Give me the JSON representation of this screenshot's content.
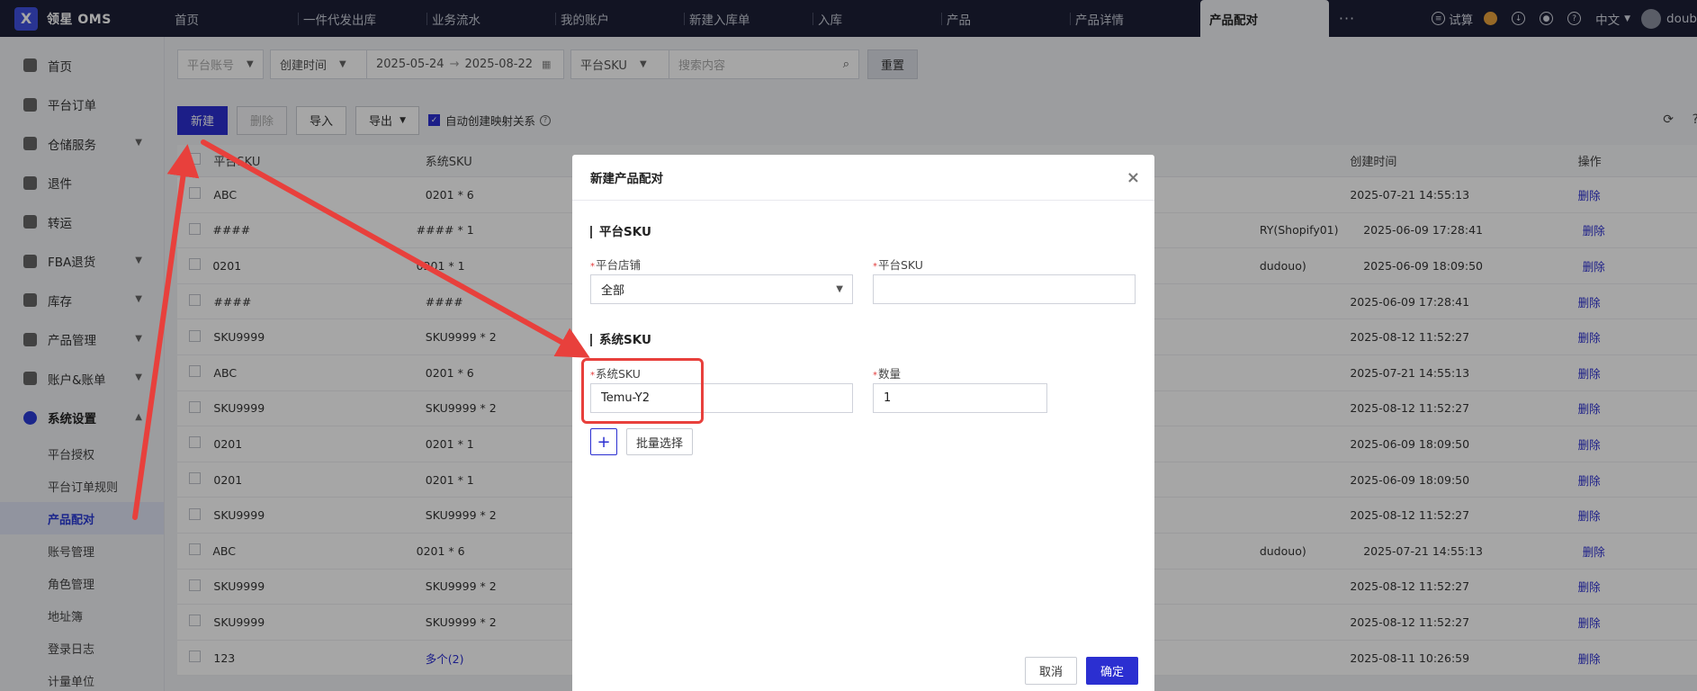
{
  "brand": {
    "name": "领星 OMS",
    "logo_letter": "X"
  },
  "top_tabs": [
    {
      "label": "首页"
    },
    {
      "label": "一件代发出库"
    },
    {
      "label": "业务流水"
    },
    {
      "label": "我的账户"
    },
    {
      "label": "新建入库单"
    },
    {
      "label": "入库"
    },
    {
      "label": "产品"
    },
    {
      "label": "产品详情"
    },
    {
      "label": "产品配对",
      "active": true
    }
  ],
  "top_more": "···",
  "top_right": {
    "trial": "试算",
    "lang": "中文",
    "user": "doub"
  },
  "sidebar": {
    "items": [
      {
        "label": "首页"
      },
      {
        "label": "平台订单"
      },
      {
        "label": "仓储服务",
        "expandable": true
      },
      {
        "label": "退件"
      },
      {
        "label": "转运"
      },
      {
        "label": "FBA退货",
        "expandable": true
      },
      {
        "label": "库存",
        "expandable": true
      },
      {
        "label": "产品管理",
        "expandable": true
      },
      {
        "label": "账户&账单",
        "expandable": true
      },
      {
        "label": "系统设置",
        "expandable": true,
        "open": true
      }
    ],
    "sub_items": [
      {
        "label": "平台授权"
      },
      {
        "label": "平台订单规则"
      },
      {
        "label": "产品配对",
        "active": true
      },
      {
        "label": "账号管理"
      },
      {
        "label": "角色管理"
      },
      {
        "label": "地址簿"
      },
      {
        "label": "登录日志"
      },
      {
        "label": "计量单位"
      }
    ]
  },
  "filters": {
    "platform_account": "平台账号",
    "time_type": "创建时间",
    "date_from": "2025-05-24",
    "date_arrow": "→",
    "date_to": "2025-08-22",
    "sku_type": "平台SKU",
    "search_placeholder": "搜索内容",
    "reset": "重置"
  },
  "toolbar": {
    "new": "新建",
    "delete": "删除",
    "import": "导入",
    "export": "导出",
    "auto_create": "自动创建映射关系"
  },
  "table": {
    "headers": {
      "platform_sku": "平台SKU",
      "system_sku": "系统SKU",
      "created": "创建时间",
      "action": "操作"
    },
    "rows": [
      {
        "psku": "ABC",
        "ssku": "0201 * 6",
        "extra": "",
        "time": "2025-07-21 14:55:13",
        "op": "删除"
      },
      {
        "psku": "####",
        "ssku": "#### * 1",
        "extra": "RY(Shopify01)",
        "time": "2025-06-09 17:28:41",
        "op": "删除"
      },
      {
        "psku": "0201",
        "ssku": "0201 * 1",
        "extra": "dudouo)",
        "time": "2025-06-09 18:09:50",
        "op": "删除"
      },
      {
        "psku": "####",
        "ssku": "####",
        "extra": "",
        "time": "2025-06-09 17:28:41",
        "op": "删除"
      },
      {
        "psku": "SKU9999",
        "ssku": "SKU9999 * 2",
        "extra": "",
        "time": "2025-08-12 11:52:27",
        "op": "删除"
      },
      {
        "psku": "ABC",
        "ssku": "0201 * 6",
        "extra": "",
        "time": "2025-07-21 14:55:13",
        "op": "删除"
      },
      {
        "psku": "SKU9999",
        "ssku": "SKU9999 * 2",
        "extra": "",
        "time": "2025-08-12 11:52:27",
        "op": "删除"
      },
      {
        "psku": "0201",
        "ssku": "0201 * 1",
        "extra": "",
        "time": "2025-06-09 18:09:50",
        "op": "删除"
      },
      {
        "psku": "0201",
        "ssku": "0201 * 1",
        "extra": "",
        "time": "2025-06-09 18:09:50",
        "op": "删除"
      },
      {
        "psku": "SKU9999",
        "ssku": "SKU9999 * 2",
        "extra": "",
        "time": "2025-08-12 11:52:27",
        "op": "删除"
      },
      {
        "psku": "ABC",
        "ssku": "0201 * 6",
        "extra": "dudouo)",
        "time": "2025-07-21 14:55:13",
        "op": "删除"
      },
      {
        "psku": "SKU9999",
        "ssku": "SKU9999 * 2",
        "extra": "",
        "time": "2025-08-12 11:52:27",
        "op": "删除"
      },
      {
        "psku": "SKU9999",
        "ssku": "SKU9999 * 2",
        "extra": "",
        "time": "2025-08-12 11:52:27",
        "op": "删除"
      },
      {
        "psku": "123",
        "ssku": "多个(2)",
        "ssku_link": true,
        "extra": "",
        "time": "2025-08-11 10:26:59",
        "op": "删除"
      }
    ]
  },
  "modal": {
    "title": "新建产品配对",
    "close": "×",
    "platform_section": "平台SKU",
    "store_label": "平台店铺",
    "store_value": "全部",
    "platform_sku_label": "平台SKU",
    "platform_sku_value": "",
    "system_section": "系统SKU",
    "system_sku_label": "系统SKU",
    "system_sku_value": "Temu-Y2",
    "qty_label": "数量",
    "qty_value": "1",
    "plus": "+",
    "batch_select": "批量选择",
    "cancel": "取消",
    "confirm": "确定",
    "required_mark": "*"
  },
  "colors": {
    "primary": "#2b2fd1",
    "annotation": "#e8403c",
    "topbar": "#1c2036"
  }
}
